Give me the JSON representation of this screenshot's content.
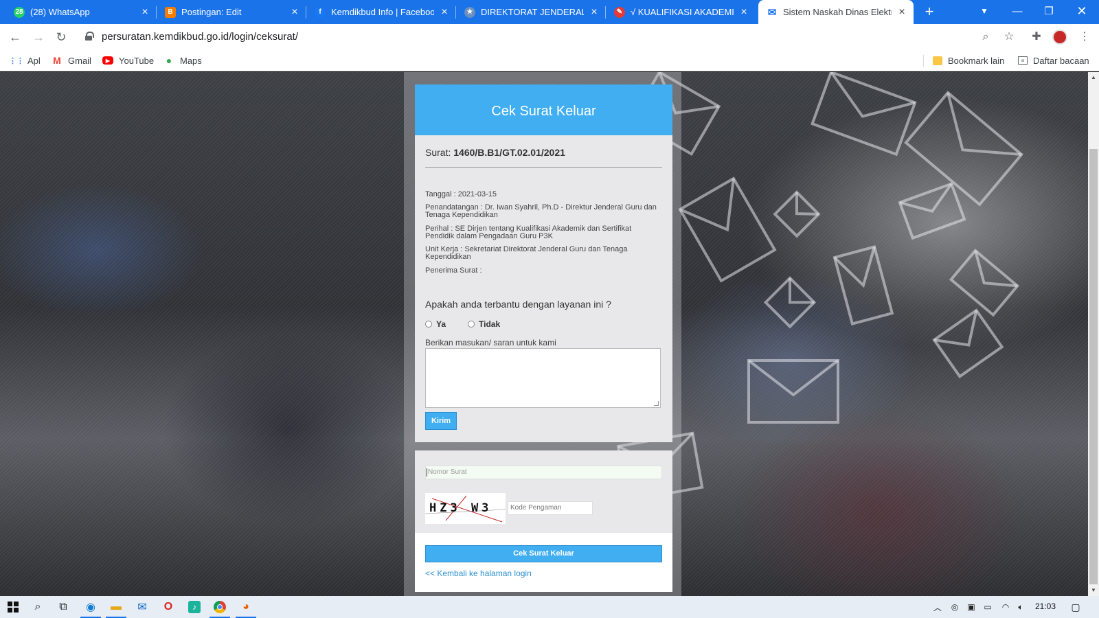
{
  "browser": {
    "tabs": [
      {
        "label": "(28) WhatsApp",
        "icon": "whatsapp-icon",
        "color": "#25d366",
        "glyph": "28"
      },
      {
        "label": "Postingan: Edit",
        "icon": "blogger-icon",
        "color": "#f57d00",
        "glyph": "B"
      },
      {
        "label": "Kemdikbud Info | Facebook",
        "icon": "facebook-icon",
        "color": "#1877f2",
        "glyph": "f"
      },
      {
        "label": "DIREKTORAT JENDERAL GTK",
        "icon": "kemdikbud-icon",
        "color": "#6b8fbf",
        "glyph": "★"
      },
      {
        "label": "√ KUALIFIKASI AKADEMIK DAN",
        "icon": "site-icon",
        "color": "#e53935",
        "glyph": "✎"
      },
      {
        "label": "Sistem Naskah Dinas Elektronik",
        "icon": "mail-icon",
        "color": "#1a73e8",
        "glyph": "✉"
      }
    ],
    "new_tab_glyph": "+",
    "url": "persuratan.kemdikbud.go.id/login/ceksurat/",
    "bookmarks": [
      {
        "label": "Apl",
        "icon": "apps-grid-icon",
        "color": "#4285f4",
        "glyph": "⋮⋮"
      },
      {
        "label": "Gmail",
        "icon": "gmail-icon",
        "color": "#ea4335",
        "glyph": "M"
      },
      {
        "label": "YouTube",
        "icon": "youtube-icon",
        "color": "#ff0000",
        "glyph": "▶"
      },
      {
        "label": "Maps",
        "icon": "maps-icon",
        "color": "#34a853",
        "glyph": "●"
      }
    ],
    "bookmark_other": "Bookmark lain",
    "reading_list": "Daftar bacaan"
  },
  "card": {
    "title": "Cek Surat Keluar",
    "surat_label": "Surat:",
    "surat_number": "1460/B.B1/GT.02.01/2021",
    "tanggal": "Tanggal : 2021-03-15",
    "penandatangan": "Penandatangan : Dr. Iwan Syahril, Ph.D - Direktur Jenderal Guru dan Tenaga Kependidikan",
    "perihal": "Perihal : SE Dirjen tentang Kualifikasi Akademik dan Sertifikat Pendidik dalam Pengadaan Guru P3K",
    "unit_kerja": "Unit Kerja : Sekretariat Direktorat Jenderal Guru dan Tenaga Kependidikan",
    "penerima": "Penerima Surat :",
    "question": "Apakah anda terbantu dengan layanan ini ?",
    "option_yes": "Ya",
    "option_no": "Tidak",
    "feedback_label": "Berikan masukan/ saran untuk kami",
    "submit_label": "Kirim"
  },
  "check_form": {
    "nomor_placeholder": "Nomor Surat",
    "captcha_text": "HZ3 W3",
    "kode_placeholder": "Kode Pengaman",
    "button_label": "Cek Surat Keluar",
    "back_link": "<< Kembali ke halaman login"
  },
  "taskbar": {
    "clock": "21:03"
  },
  "colors": {
    "header_blue": "#40aef0",
    "chrome_blue": "#1a73e8"
  }
}
